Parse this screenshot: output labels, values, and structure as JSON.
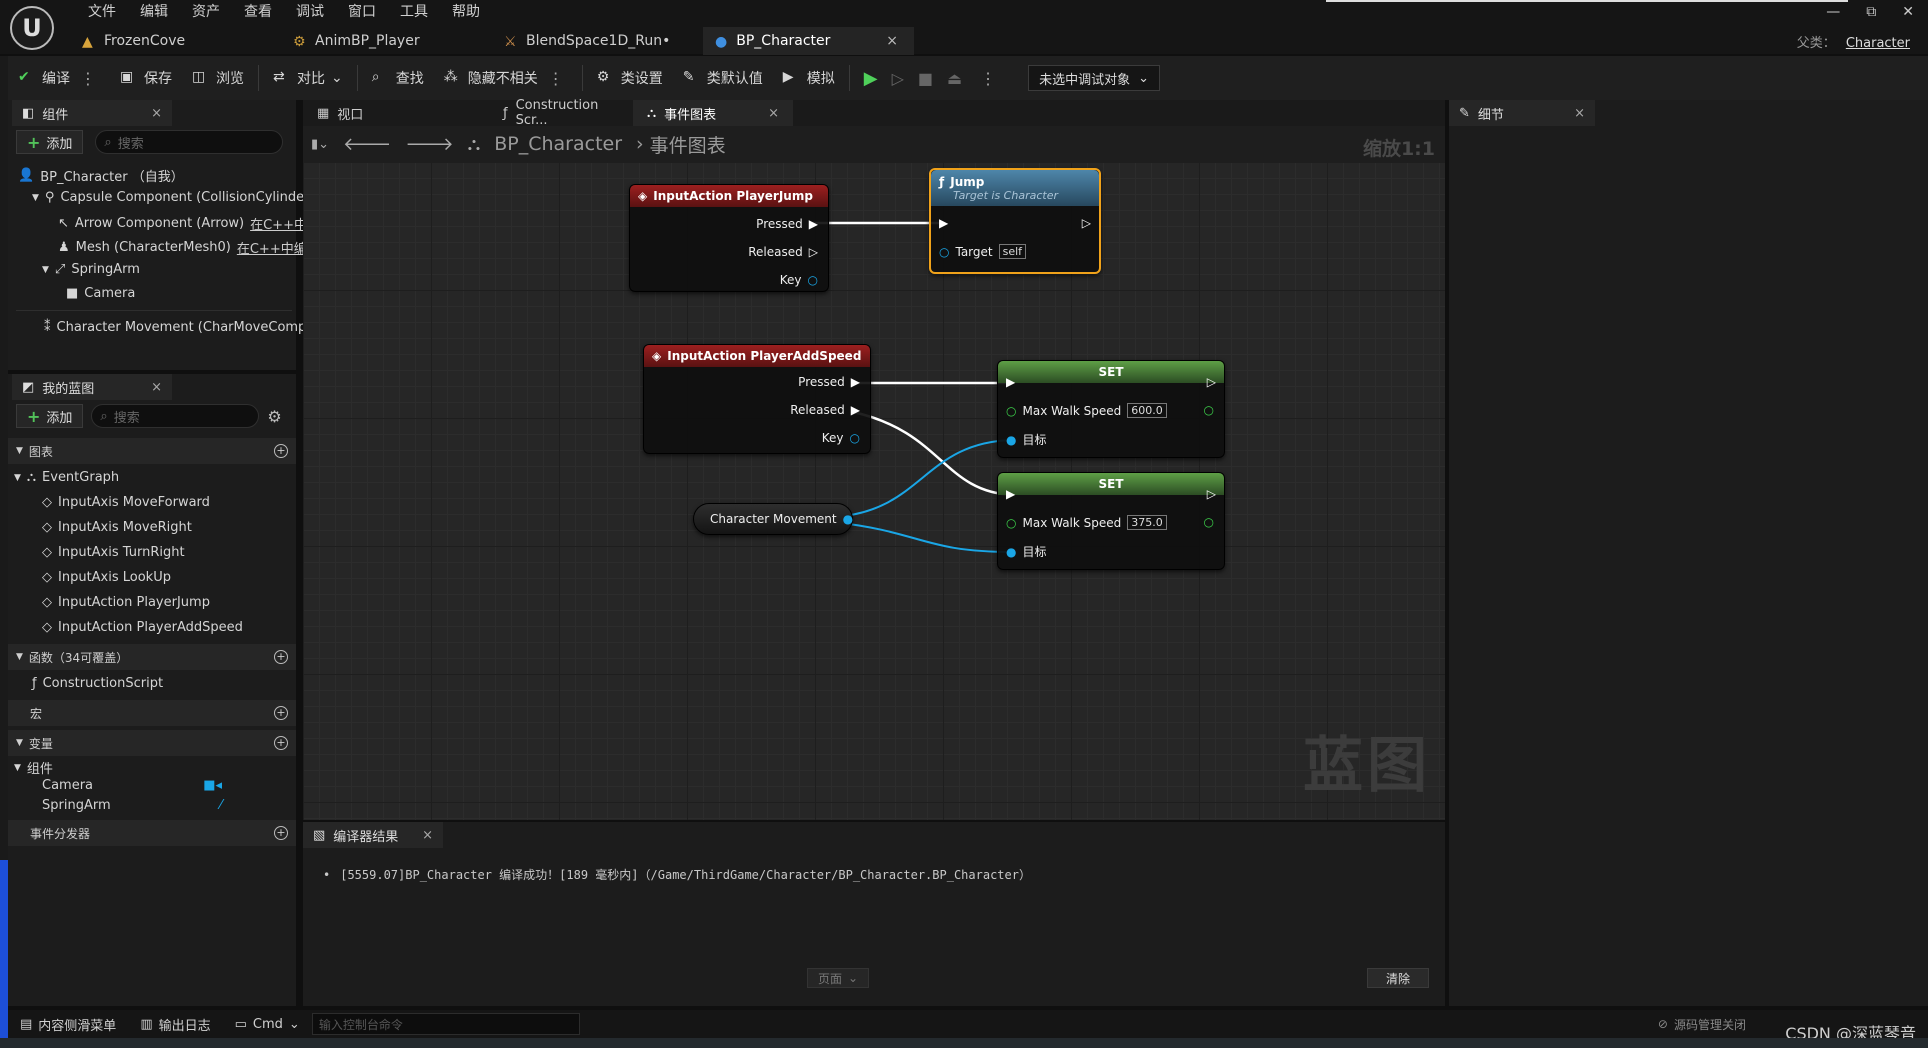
{
  "menu": [
    "文件",
    "编辑",
    "资产",
    "查看",
    "调试",
    "窗口",
    "工具",
    "帮助"
  ],
  "doc_tabs": [
    "FrozenCove",
    "AnimBP_Player",
    "BlendSpace1D_Run•",
    "BP_Character"
  ],
  "doc_tab_close": "×",
  "window": {
    "minimize": "—",
    "restore": "⧉",
    "close": "✕",
    "parent_label": "父类：",
    "parent_value": "Character"
  },
  "toolbar": {
    "compile": "编译",
    "save": "保存",
    "browse": "浏览",
    "diff": "对比",
    "find": "查找",
    "hide_unrelated": "隐藏不相关",
    "class_settings": "类设置",
    "class_defaults": "类默认值",
    "simulate": "模拟",
    "debug_select": "未选中调试对象"
  },
  "components_panel": {
    "title": "组件",
    "add": "添加",
    "search_placeholder": "搜索",
    "tree": [
      {
        "label": "BP_Character （自我）"
      },
      {
        "label": "Capsule Component (CollisionCylinder)"
      },
      {
        "label": "Arrow Component (Arrow)",
        "link": "在C++中编"
      },
      {
        "label": "Mesh (CharacterMesh0)",
        "link": "在C++中编辑"
      },
      {
        "label": "SpringArm"
      },
      {
        "label": "Camera"
      },
      {
        "label": "Character Movement (CharMoveComp)"
      }
    ]
  },
  "myblueprint_panel": {
    "title": "我的蓝图",
    "add": "添加",
    "search_placeholder": "搜索",
    "graphs_header": "图表",
    "event_graph": "EventGraph",
    "events": [
      "InputAxis MoveForward",
      "InputAxis MoveRight",
      "InputAxis TurnRight",
      "InputAxis LookUp",
      "InputAction PlayerJump",
      "InputAction PlayerAddSpeed"
    ],
    "functions_header": "函数（34可覆盖）",
    "construction_script": "ConstructionScript",
    "macros_header": "宏",
    "variables_header": "变量",
    "components_group": "组件",
    "variables": [
      "Camera",
      "SpringArm"
    ],
    "dispatchers_header": "事件分发器"
  },
  "center_tabs": [
    "视口",
    "Construction Scr...",
    "事件图表"
  ],
  "breadcrumb": {
    "bp": "BP_Character",
    "graph": "事件图表",
    "separator": "›",
    "zoom": "缩放1:1"
  },
  "nodes": {
    "jump_event": {
      "title": "InputAction PlayerJump",
      "pressed": "Pressed",
      "released": "Released",
      "key": "Key"
    },
    "jump_func": {
      "title": "Jump",
      "subtitle": "Target is Character",
      "target": "Target",
      "self": "self"
    },
    "speed_event": {
      "title": "InputAction PlayerAddSpeed",
      "pressed": "Pressed",
      "released": "Released",
      "key": "Key"
    },
    "set1": {
      "title": "SET",
      "prop": "Max Walk Speed",
      "value": "600.0",
      "target": "目标"
    },
    "set2": {
      "title": "SET",
      "prop": "Max Walk Speed",
      "value": "375.0",
      "target": "目标"
    },
    "char_movement": {
      "label": "Character Movement"
    }
  },
  "watermark": "蓝图",
  "output": {
    "title": "编译器结果",
    "log": "[5559.07]BP_Character 编译成功！[189 毫秒内]（/Game/ThirdGame/Character/BP_Character.BP_Character）",
    "page": "页面",
    "clear": "清除"
  },
  "details": {
    "title": "细节"
  },
  "statusbar": {
    "content_drawer": "内容侧滑菜单",
    "output_log": "输出日志",
    "cmd": "Cmd",
    "console_placeholder": "输入控制台命令",
    "source_control": "源码管理关闭"
  },
  "watermark_csdn": "CSDN @深蓝琴音",
  "colors": {
    "exec": "#ffffff",
    "object_pin": "#1aa6e6",
    "float_pin": "#3ccf4a",
    "event_header": "#9c1f1f",
    "function_header": "#3e6e8e",
    "set_header": "#4f8f3a",
    "selected_outline": "#f0a21a"
  }
}
